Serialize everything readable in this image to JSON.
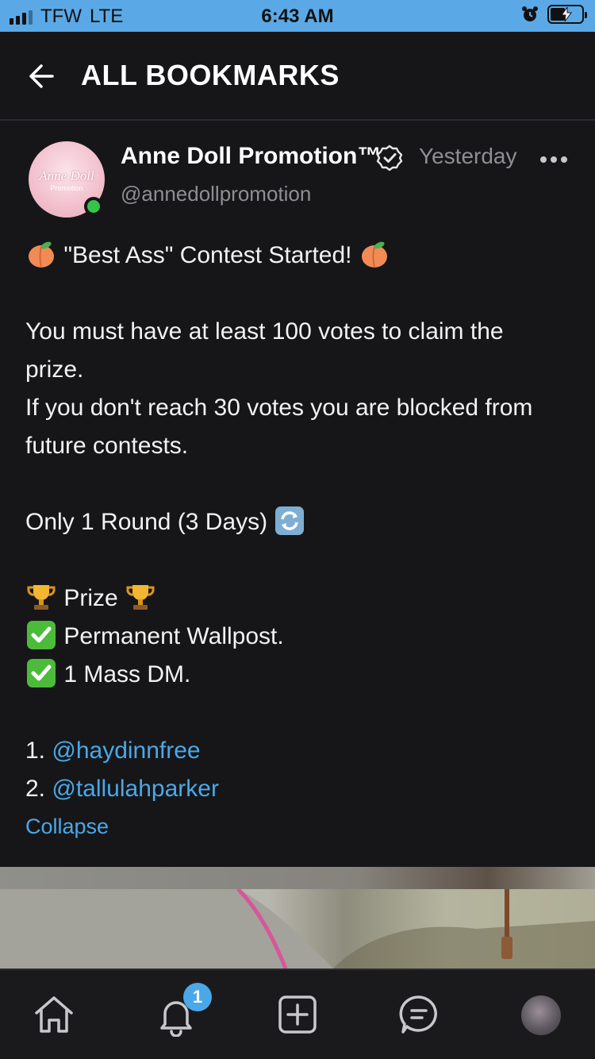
{
  "status_bar": {
    "carrier": "TFW",
    "network": "LTE",
    "time": "6:43 AM"
  },
  "header": {
    "title": "ALL BOOKMARKS"
  },
  "post": {
    "author_name": "Anne Doll Promotion™",
    "handle": "@annedollpromotion",
    "timestamp": "Yesterday",
    "verified": true,
    "online": true,
    "avatar_text": "Anne Doll",
    "avatar_subtext": "Promotion",
    "body": {
      "headline": "\"Best Ass\" Contest Started!",
      "rule_line1": "You must have at least 100 votes to claim the",
      "rule_line2": "prize.",
      "rule_line3": "If you don't reach 30 votes you are blocked from",
      "rule_line4": "future contests.",
      "round_info": "Only 1 Round (3 Days)",
      "prize_heading": "Prize",
      "prize_1": "Permanent Wallpost.",
      "prize_2": "1 Mass DM.",
      "entrant_1_num": "1.",
      "entrant_1": "@haydinnfree",
      "entrant_2_num": "2.",
      "entrant_2": "@tallulahparker"
    },
    "collapse_label": "Collapse"
  },
  "bottom_nav": {
    "items": [
      "home-icon",
      "notifications-icon",
      "add-post-icon",
      "messages-icon",
      "profile-avatar"
    ],
    "notification_count": "1"
  },
  "colors": {
    "background": "#161618",
    "accent": "#4aa8e8",
    "status_bar": "#5aa9e6",
    "muted_text": "#8e8e93",
    "online": "#37c24a"
  }
}
